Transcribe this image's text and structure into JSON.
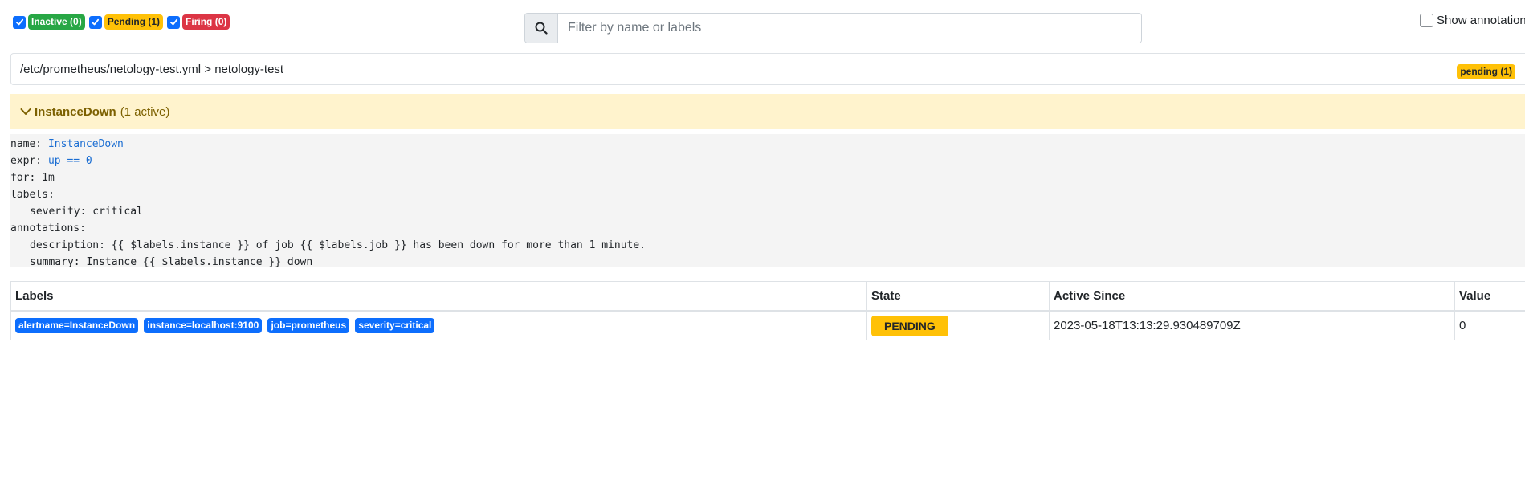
{
  "filters": {
    "inactive": "Inactive (0)",
    "pending": "Pending (1)",
    "firing": "Firing (0)"
  },
  "search": {
    "placeholder": "Filter by name or labels"
  },
  "show_annotations": "Show annotations",
  "group": {
    "path": "/etc/prometheus/netology-test.yml > netology-test",
    "badge": "pending (1)"
  },
  "rule": {
    "name": "InstanceDown",
    "count": "(1 active)",
    "definition": {
      "name_key": "name:",
      "name_val": "InstanceDown",
      "expr_key": "expr:",
      "expr_val": "up == 0",
      "for": "for: 1m",
      "labels_key": "labels:",
      "severity": "severity: critical",
      "annotations_key": "annotations:",
      "description": "description: {{ $labels.instance }} of job {{ $labels.job }} has been down for more than 1 minute.",
      "summary": "summary: Instance {{ $labels.instance }} down"
    }
  },
  "table": {
    "headers": [
      "Labels",
      "State",
      "Active Since",
      "Value"
    ],
    "rows": [
      {
        "labels": [
          "alertname=InstanceDown",
          "instance=localhost:9100",
          "job=prometheus",
          "severity=critical"
        ],
        "state": "PENDING",
        "active_since": "2023-05-18T13:13:29.930489709Z",
        "value": "0"
      }
    ]
  },
  "colors": {
    "inactive": "#28a745",
    "pending": "#ffc107",
    "firing": "#dc3545",
    "label": "#0d6efd",
    "rule_header_bg": "#fff3cd"
  },
  "icons": [
    "check-icon",
    "search-icon",
    "chevron-down-icon"
  ]
}
